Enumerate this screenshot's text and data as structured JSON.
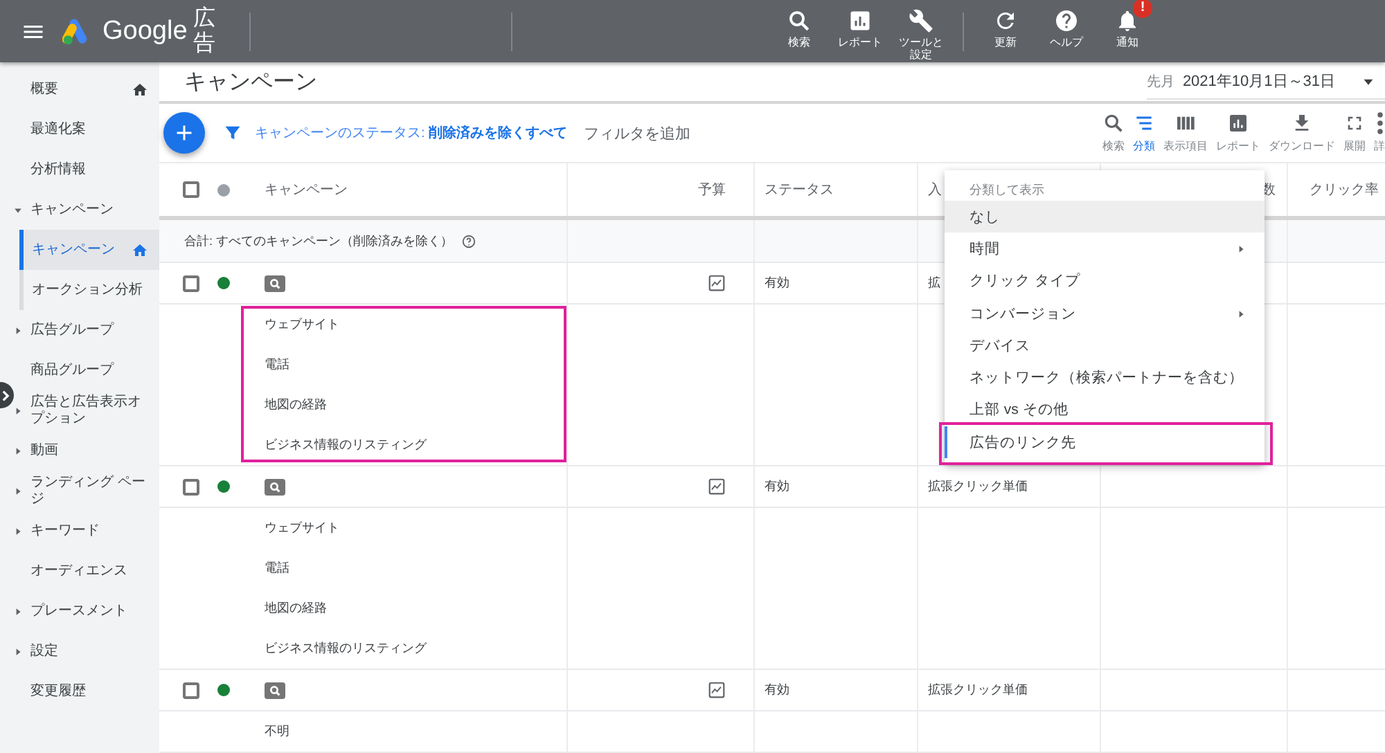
{
  "header": {
    "logo_text": "Google",
    "product": "広告",
    "action_groups": [
      [
        {
          "label": "検索"
        },
        {
          "label": "レポート"
        },
        {
          "label": "ツールと設定"
        }
      ],
      [
        {
          "label": "更新"
        },
        {
          "label": "ヘルプ"
        },
        {
          "label": "通知",
          "badge": "!"
        }
      ]
    ]
  },
  "sidebar": {
    "items": [
      {
        "label": "概要",
        "home": true,
        "selected": false
      },
      {
        "label": "最適化案",
        "home": false,
        "selected": false
      },
      {
        "label": "分析情報",
        "home": false,
        "selected": false
      },
      {
        "label": "キャンペーン",
        "home": false,
        "selected": false,
        "expanded": true,
        "children": [
          {
            "label": "キャンペーン",
            "home": true,
            "selected": true
          },
          {
            "label": "オークション分析",
            "home": false,
            "selected": false
          }
        ]
      },
      {
        "label": "広告グループ",
        "home": false,
        "selected": false,
        "expanded": false
      },
      {
        "label": "商品グループ",
        "home": false,
        "selected": false
      },
      {
        "label": "広告と広告表示オプション",
        "home": false,
        "selected": false,
        "expanded": false
      },
      {
        "label": "動画",
        "home": false,
        "selected": false,
        "expanded": false
      },
      {
        "label": "ランディング ページ",
        "home": false,
        "selected": false,
        "expanded": false
      },
      {
        "label": "キーワード",
        "home": false,
        "selected": false,
        "expanded": false
      },
      {
        "label": "オーディエンス",
        "home": false,
        "selected": false
      },
      {
        "label": "プレースメント",
        "home": false,
        "selected": false,
        "expanded": false
      },
      {
        "label": "設定",
        "home": false,
        "selected": false,
        "expanded": false
      },
      {
        "label": "変更履歴",
        "home": false,
        "selected": false
      }
    ]
  },
  "page": {
    "title": "キャンペーン",
    "date_range": {
      "label": "先月",
      "value": "2021年10月1日～31日"
    }
  },
  "toolbar": {
    "filter": "キャンペーンのステータス: **削除済みを除くすべて**",
    "add_filter": "フィルタを追加",
    "tools": [
      {
        "label": "検索",
        "selected": false
      },
      {
        "label": "分類",
        "selected": true
      },
      {
        "label": "表示項目",
        "selected": false
      },
      {
        "label": "レポート",
        "selected": false
      },
      {
        "label": "ダウンロード",
        "selected": false
      },
      {
        "label": "展開",
        "selected": false
      },
      {
        "label": "詳",
        "selected": false
      }
    ]
  },
  "table": {
    "columns": [
      "キャンペーン",
      "予算",
      "ステータス",
      "入",
      "数",
      "クリック率"
    ],
    "header_checked": false,
    "total": "合計: すべてのキャンペーン（削除済みを除く）",
    "rows": [
      {
        "checked": false,
        "color": "#188038",
        "status": "有効",
        "bid_strategy": "拡",
        "highlighted": true,
        "segments": [
          "ウェブサイト",
          "電話",
          "地図の経路",
          "ビジネス情報のリスティング"
        ]
      },
      {
        "checked": false,
        "color": "#188038",
        "status": "有効",
        "bid_strategy": "拡張クリック単価",
        "highlighted": false,
        "segments": [
          "ウェブサイト",
          "電話",
          "地図の経路",
          "ビジネス情報のリスティング"
        ]
      },
      {
        "checked": false,
        "color": "#188038",
        "status": "有効",
        "bid_strategy": "拡張クリック単価",
        "highlighted": false,
        "segments": [
          "不明"
        ]
      }
    ]
  },
  "segment_menu": {
    "title": "分類して表示",
    "items": [
      {
        "label": "なし",
        "hovered": true,
        "has_submenu": false,
        "selected": false,
        "highlighted": false
      },
      {
        "label": "時間",
        "hovered": false,
        "has_submenu": true,
        "selected": false,
        "highlighted": false
      },
      {
        "label": "クリック タイプ",
        "hovered": false,
        "has_submenu": false,
        "selected": false,
        "highlighted": false
      },
      {
        "label": "コンバージョン",
        "hovered": false,
        "has_submenu": true,
        "selected": false,
        "highlighted": false
      },
      {
        "label": "デバイス",
        "hovered": false,
        "has_submenu": false,
        "selected": false,
        "highlighted": false
      },
      {
        "label": "ネットワーク（検索パートナーを含む）",
        "hovered": false,
        "has_submenu": false,
        "selected": false,
        "highlighted": false
      },
      {
        "label": "上部 vs その他",
        "hovered": false,
        "has_submenu": false,
        "selected": false,
        "highlighted": false
      },
      {
        "label": "広告のリンク先",
        "hovered": false,
        "has_submenu": false,
        "selected": true,
        "highlighted": true
      }
    ]
  }
}
